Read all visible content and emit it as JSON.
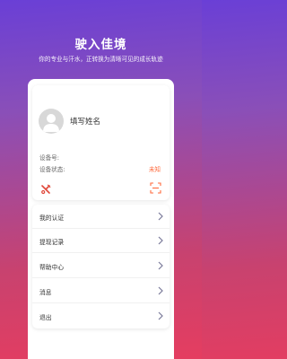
{
  "hero": {
    "title": "驶入佳境",
    "subtitle": "你的专业与汗水，正转换为清晰可见的成长轨迹"
  },
  "profile": {
    "avatar_icon": "person-avatar-icon",
    "name_placeholder": "填写姓名",
    "device_id_label": "设备号:",
    "device_status_label": "设备状态:",
    "device_status_value": "未知",
    "tools_icon": "tools-icon",
    "scan_icon": "scan-icon"
  },
  "menu": {
    "items": [
      {
        "label": "我的认证"
      },
      {
        "label": "提现记录"
      },
      {
        "label": "帮助中心"
      },
      {
        "label": "消息"
      },
      {
        "label": "退出"
      }
    ]
  },
  "colors": {
    "gradient_top": "#6a3fd6",
    "gradient_bottom": "#e53d60",
    "status_orange": "#ff6a3d",
    "tool_red": "#e0483a"
  }
}
